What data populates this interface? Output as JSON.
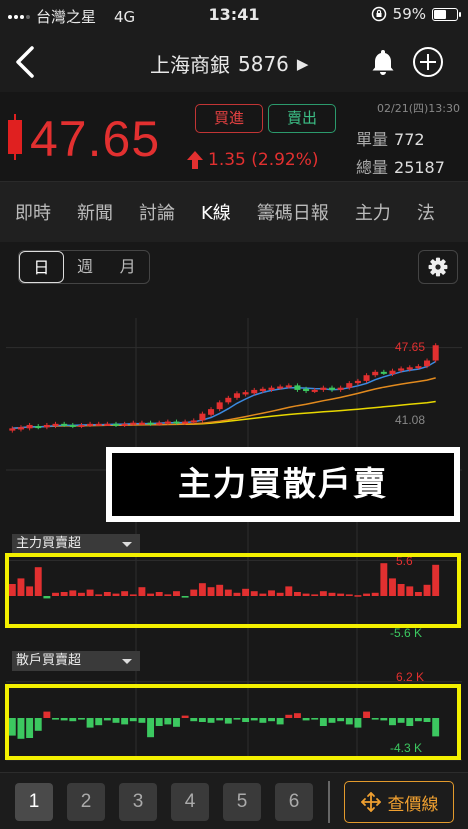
{
  "status_bar": {
    "carrier": "台灣之星",
    "network": "4G",
    "time": "13:41",
    "battery": "59%",
    "battery_level": 0.59
  },
  "header": {
    "stock_name": "上海商銀",
    "stock_code": "5876",
    "arrow": "▶"
  },
  "quote": {
    "price": "47.65",
    "buy_label": "買進",
    "sell_label": "賣出",
    "change": "1.35 (2.92%)",
    "datetime": "02/21(四)13:30",
    "volume_label": "單量",
    "volume_value": "772",
    "total_label": "總量",
    "total_value": "25187"
  },
  "tabs": [
    "即時",
    "新聞",
    "討論",
    "K線",
    "籌碼日報",
    "主力",
    "法"
  ],
  "active_tab": "K線",
  "period_tabs": [
    "日",
    "週",
    "月"
  ],
  "active_period": "日",
  "overlay_label": "主力買散戶賣",
  "indicators": {
    "main_force_label": "主力買賣超",
    "main_force_max": "5.6",
    "main_force_min": "-5.6 K",
    "retail_label": "散戶買賣超",
    "retail_max": "6.2 K",
    "retail_min": "-4.3 K"
  },
  "chart_labels": {
    "high": "47.65",
    "low": "41.08"
  },
  "bottom": {
    "pages": [
      "1",
      "2",
      "3",
      "4",
      "5",
      "6"
    ],
    "active_page": "1",
    "price_line_label": "查價線"
  },
  "colors": {
    "up": "#e23030",
    "down": "#3cc860",
    "highlight": "#f3f000",
    "accent": "#f0a030"
  },
  "chart_data": {
    "type": "candlestick",
    "price_axis": {
      "high_label": "47.65",
      "low_label": "41.08",
      "ylim": [
        37.5,
        49
      ]
    },
    "candles": [
      {
        "o": 40.1,
        "c": 40.3
      },
      {
        "o": 40.2,
        "c": 40.4
      },
      {
        "o": 40.3,
        "c": 40.6
      },
      {
        "o": 40.5,
        "c": 40.4
      },
      {
        "o": 40.4,
        "c": 40.6
      },
      {
        "o": 40.5,
        "c": 40.7
      },
      {
        "o": 40.7,
        "c": 40.6
      },
      {
        "o": 40.6,
        "c": 40.5
      },
      {
        "o": 40.5,
        "c": 40.6
      },
      {
        "o": 40.6,
        "c": 40.7
      },
      {
        "o": 40.7,
        "c": 40.7
      },
      {
        "o": 40.7,
        "c": 40.7
      },
      {
        "o": 40.7,
        "c": 40.6
      },
      {
        "o": 40.6,
        "c": 40.7
      },
      {
        "o": 40.7,
        "c": 40.8
      },
      {
        "o": 40.8,
        "c": 40.8
      },
      {
        "o": 40.8,
        "c": 40.7
      },
      {
        "o": 40.7,
        "c": 40.8
      },
      {
        "o": 40.8,
        "c": 40.9
      },
      {
        "o": 40.9,
        "c": 40.8
      },
      {
        "o": 40.8,
        "c": 40.9
      },
      {
        "o": 40.9,
        "c": 41.0
      },
      {
        "o": 41.0,
        "c": 41.6
      },
      {
        "o": 41.5,
        "c": 42.0
      },
      {
        "o": 42.0,
        "c": 42.6
      },
      {
        "o": 42.6,
        "c": 43.0
      },
      {
        "o": 43.0,
        "c": 43.4
      },
      {
        "o": 43.3,
        "c": 43.5
      },
      {
        "o": 43.4,
        "c": 43.7
      },
      {
        "o": 43.6,
        "c": 43.8
      },
      {
        "o": 43.7,
        "c": 43.9
      },
      {
        "o": 43.9,
        "c": 44.0
      },
      {
        "o": 44.0,
        "c": 44.1
      },
      {
        "o": 44.1,
        "c": 43.7
      },
      {
        "o": 43.8,
        "c": 43.6
      },
      {
        "o": 43.6,
        "c": 43.7
      },
      {
        "o": 43.7,
        "c": 43.9
      },
      {
        "o": 43.9,
        "c": 43.7
      },
      {
        "o": 43.7,
        "c": 43.9
      },
      {
        "o": 43.9,
        "c": 44.3
      },
      {
        "o": 44.3,
        "c": 44.5
      },
      {
        "o": 44.5,
        "c": 45.0
      },
      {
        "o": 45.0,
        "c": 45.3
      },
      {
        "o": 45.3,
        "c": 45.2
      },
      {
        "o": 45.1,
        "c": 45.4
      },
      {
        "o": 45.4,
        "c": 45.6
      },
      {
        "o": 45.5,
        "c": 45.7
      },
      {
        "o": 45.7,
        "c": 45.8
      },
      {
        "o": 45.8,
        "c": 46.3
      },
      {
        "o": 46.3,
        "c": 47.65
      }
    ],
    "main_force": [
      1.5,
      2.2,
      1.2,
      3.6,
      -0.3,
      0.4,
      0.5,
      0.7,
      0.4,
      0.8,
      0.2,
      0.5,
      0.3,
      0.6,
      0.2,
      1.1,
      0.3,
      0.5,
      0.2,
      0.6,
      -0.2,
      0.8,
      1.6,
      1.1,
      1.4,
      0.8,
      0.4,
      0.9,
      0.6,
      0.3,
      0.7,
      0.4,
      1.2,
      0.5,
      0.3,
      0.2,
      0.6,
      0.4,
      0.3,
      0.2,
      0.1,
      0.3,
      0.4,
      4.1,
      2.2,
      1.5,
      1.2,
      0.5,
      1.4,
      3.9
    ],
    "retail": [
      -2.2,
      -2.6,
      -2.5,
      -1.6,
      0.8,
      -0.2,
      -0.3,
      -0.4,
      -0.2,
      -1.2,
      -0.9,
      -0.3,
      -0.6,
      -0.8,
      -0.4,
      -0.6,
      -2.4,
      -1.0,
      -0.8,
      -1.1,
      0.3,
      -0.4,
      -0.5,
      -0.6,
      -0.3,
      -0.7,
      -0.2,
      -0.5,
      -0.3,
      -0.6,
      -0.4,
      -0.8,
      0.4,
      0.6,
      -0.3,
      -0.2,
      -1.0,
      -0.6,
      -0.4,
      -0.8,
      -1.2,
      0.8,
      -0.2,
      -0.3,
      -0.9,
      -0.6,
      -1.0,
      -0.4,
      -0.5,
      -2.3
    ]
  }
}
